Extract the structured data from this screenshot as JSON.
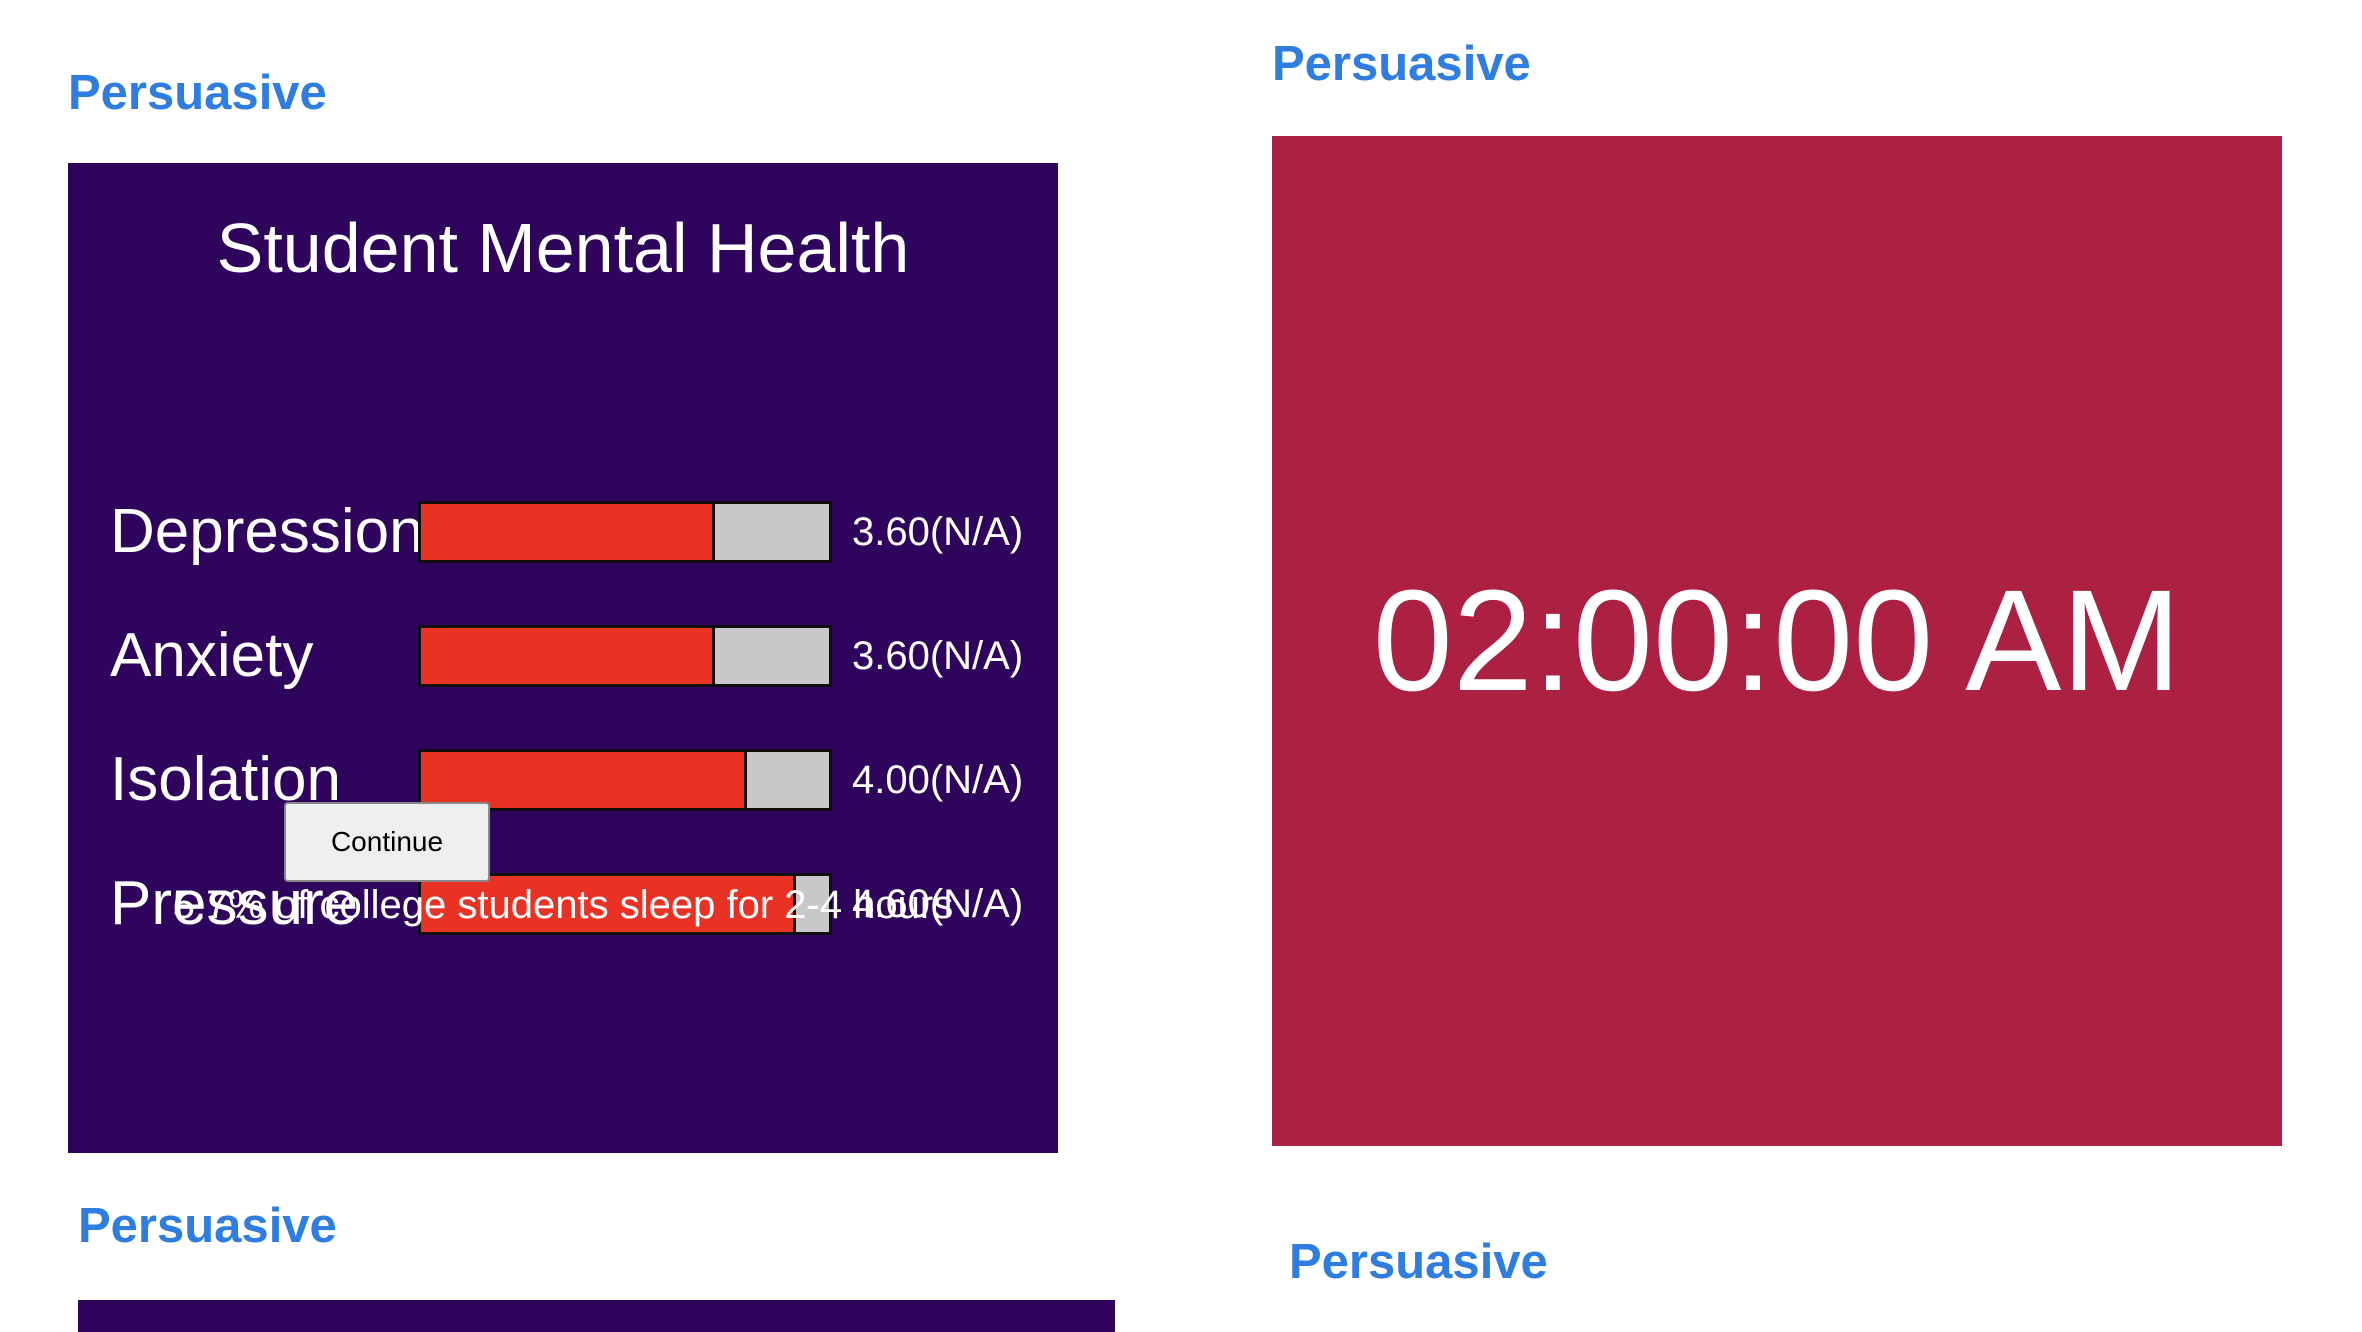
{
  "cards": [
    {
      "heading": "Persuasive"
    },
    {
      "heading": "Persuasive"
    },
    {
      "heading": "Persuasive"
    },
    {
      "heading": "Persuasive"
    }
  ],
  "mental_health": {
    "title": "Student Mental Health",
    "metrics": [
      {
        "label": "Depression",
        "value_text": "3.60(N/A)",
        "value": 3.6,
        "fill_fraction": 0.72
      },
      {
        "label": "Anxiety",
        "value_text": "3.60(N/A)",
        "value": 3.6,
        "fill_fraction": 0.72
      },
      {
        "label": "Isolation",
        "value_text": "4.00(N/A)",
        "value": 4.0,
        "fill_fraction": 0.8
      },
      {
        "label": "Pressure",
        "value_text": "4.60(N/A)",
        "value": 4.6,
        "fill_fraction": 0.92
      }
    ],
    "continue_label": "Continue",
    "footnote": "5.7% of college students sleep for 2-4 hours"
  },
  "clock": {
    "time": "02:00:00 AM"
  },
  "colors": {
    "heading_blue": "#2f7de1",
    "panel_purple": "#2e045c",
    "panel_red": "#ac2142",
    "bar_fill_red": "#ea3224",
    "bar_track_gray": "#c8c8c8"
  }
}
